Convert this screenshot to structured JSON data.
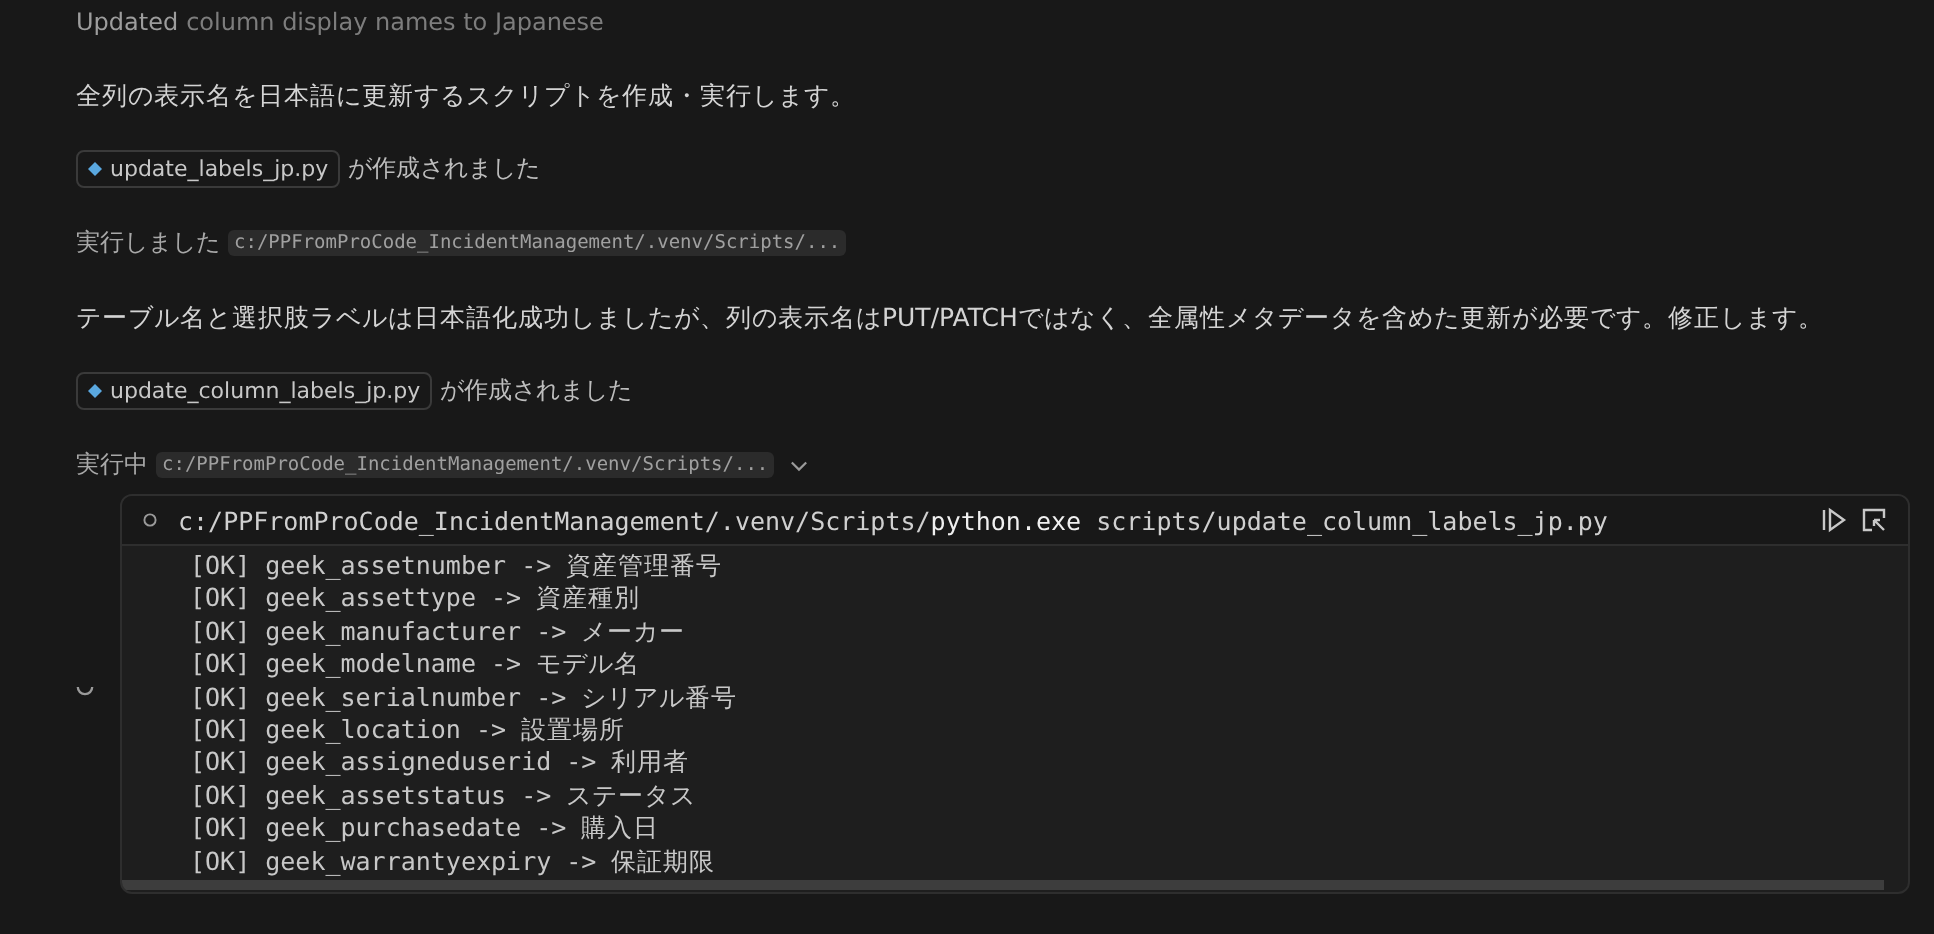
{
  "header": {
    "status": "Updated",
    "summary": "column display names to Japanese"
  },
  "steps": [
    {
      "kind": "text",
      "text": "全列の表示名を日本語に更新するスクリプトを作成・実行します。"
    },
    {
      "kind": "file",
      "file": "update_labels_jp.py",
      "text": "が作成されました"
    },
    {
      "kind": "run",
      "text": "実行しました",
      "path": "c:/PPFromProCode_IncidentManagement/.venv/Scripts/..."
    },
    {
      "kind": "text",
      "text": "テーブル名と選択肢ラベルは日本語化成功しましたが、列の表示名はPUT/PATCHではなく、全属性メタデータを含めた更新が必要です。修正します。"
    },
    {
      "kind": "file",
      "file": "update_column_labels_jp.py",
      "text": "が作成されました"
    },
    {
      "kind": "run",
      "text": "実行中",
      "path": "c:/PPFromProCode_IncidentManagement/.venv/Scripts/...",
      "expanded": true
    }
  ],
  "terminal": {
    "running": true,
    "command": "c:/PPFromProCode_IncidentManagement/.venv/Scripts/**python.exe** scripts/update_column_labels_jp.py",
    "output": [
      "[OK] geek_assetnumber -> 資産管理番号",
      "[OK] geek_assettype -> 資産種別",
      "[OK] geek_manufacturer -> メーカー",
      "[OK] geek_modelname -> モデル名",
      "[OK] geek_serialnumber -> シリアル番号",
      "[OK] geek_location -> 設置場所",
      "[OK] geek_assigneduserid -> 利用者",
      "[OK] geek_assetstatus -> ステータス",
      "[OK] geek_purchasedate -> 購入日",
      "[OK] geek_warrantyexpiry -> 保証期限"
    ]
  }
}
